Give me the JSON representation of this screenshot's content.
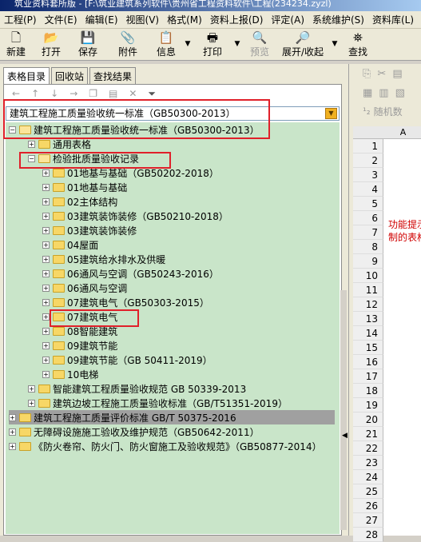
{
  "window": {
    "title": "筑业资料套所版 - [F:\\筑业建筑系列软件\\贵州省工程资料软件\\工程(234234.zyzl)"
  },
  "menu": [
    "工程(P)",
    "文件(E)",
    "编辑(E)",
    "视图(V)",
    "格式(M)",
    "资料上报(D)",
    "评定(A)",
    "系统维护(S)",
    "资料库(L)",
    "技"
  ],
  "toolbar": {
    "new": "新建",
    "open": "打开",
    "save": "保存",
    "attach": "附件",
    "info": "信息",
    "print": "打印",
    "preview": "预览",
    "expand": "展开/收起",
    "find": "查找"
  },
  "tabs": [
    "表格目录",
    "回收站",
    "查找结果"
  ],
  "combo_value": "建筑工程施工质量验收统一标准（GB50300-2013）",
  "tree": {
    "root": "建筑工程施工质量验收统一标准（GB50300-2013）",
    "general_forms": "通用表格",
    "inspection": "检验批质量验收记录",
    "items": [
      "01地基与基础（GB50202-2018）",
      "01地基与基础",
      "02主体结构",
      "03建筑装饰装修（GB50210-2018）",
      "03建筑装饰装修",
      "04屋面",
      "05建筑给水排水及供暖",
      "06通风与空调（GB50243-2016）",
      "06通风与空调",
      "07建筑电气（GB50303-2015）",
      "07建筑电气",
      "08智能建筑",
      "09建筑节能",
      "09建筑节能（GB 50411-2019）",
      "10电梯"
    ],
    "sub_standards": [
      "智能建筑工程质量验收规范 GB 50339-2013",
      "建筑边坡工程施工质量验收标准（GB/T51351-2019）"
    ],
    "top_standards": [
      "建筑工程施工质量评价标准 GB/T 50375-2016",
      "无障碍设施施工验收及维护规范（GB50642-2011）",
      "《防火卷帘、防火门、防火窗施工及验收规范》（GB50877-2014）"
    ]
  },
  "right_panel": {
    "random": "随机数",
    "col_a": "A",
    "rows": [
      "1",
      "2",
      "3",
      "4",
      "5",
      "6",
      "7",
      "8",
      "9",
      "10",
      "11",
      "12",
      "13",
      "14",
      "15",
      "16",
      "17",
      "18",
      "19",
      "20",
      "21",
      "22",
      "23",
      "24",
      "25",
      "26",
      "27",
      "28"
    ],
    "note1": "功能提示",
    "note2": "制的表格"
  }
}
